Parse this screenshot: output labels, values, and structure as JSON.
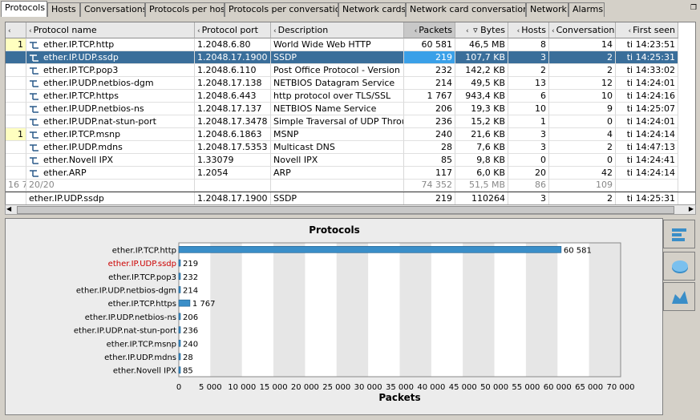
{
  "tabs": [
    "Protocols",
    "Hosts",
    "Conversations",
    "Protocols per host",
    "Protocols per conversation",
    "Network cards",
    "Network card conversations",
    "Network",
    "Alarms"
  ],
  "restore_icon": "restore-window-icon",
  "columns": [
    "",
    "Protocol name",
    "Protocol port",
    "Description",
    "Packets",
    "Bytes",
    "Hosts",
    "Conversations",
    "First seen"
  ],
  "rows": [
    [
      "1",
      "ether.IP.TCP.http",
      "1.2048.6.80",
      "World Wide Web HTTP",
      "60 581",
      "46,5 MB",
      "8",
      "14",
      "ti 14:23:51"
    ],
    [
      "",
      "ether.IP.UDP.ssdp",
      "1.2048.17.1900",
      "SSDP",
      "219",
      "107,7 KB",
      "3",
      "2",
      "ti 14:25:31"
    ],
    [
      "",
      "ether.IP.TCP.pop3",
      "1.2048.6.110",
      "Post Office Protocol - Version 3",
      "232",
      "142,2 KB",
      "2",
      "2",
      "ti 14:33:02"
    ],
    [
      "",
      "ether.IP.UDP.netbios-dgm",
      "1.2048.17.138",
      "NETBIOS Datagram Service",
      "214",
      "49,5 KB",
      "13",
      "12",
      "ti 14:24:01"
    ],
    [
      "",
      "ether.IP.TCP.https",
      "1.2048.6.443",
      "http protocol over TLS/SSL",
      "1 767",
      "943,4 KB",
      "6",
      "10",
      "ti 14:24:16"
    ],
    [
      "",
      "ether.IP.UDP.netbios-ns",
      "1.2048.17.137",
      "NETBIOS Name Service",
      "206",
      "19,3 KB",
      "10",
      "9",
      "ti 14:25:07"
    ],
    [
      "",
      "ether.IP.UDP.nat-stun-port",
      "1.2048.17.3478",
      "Simple Traversal of UDP Through",
      "236",
      "15,2 KB",
      "1",
      "0",
      "ti 14:24:01"
    ],
    [
      "1",
      "ether.IP.TCP.msnp",
      "1.2048.6.1863",
      "MSNP",
      "240",
      "21,6 KB",
      "3",
      "4",
      "ti 14:24:14"
    ],
    [
      "",
      "ether.IP.UDP.mdns",
      "1.2048.17.5353",
      "Multicast DNS",
      "28",
      "7,6 KB",
      "3",
      "2",
      "ti 14:47:13"
    ],
    [
      "",
      "ether.Novell IPX",
      "1.33079",
      "Novell IPX",
      "85",
      "9,8 KB",
      "0",
      "0",
      "ti 14:24:41"
    ],
    [
      "",
      "ether.ARP",
      "1.2054",
      "ARP",
      "117",
      "6,0 KB",
      "20",
      "42",
      "ti 14:24:14"
    ]
  ],
  "totals": [
    "16 7",
    "20/20",
    "",
    "",
    "74 352",
    "51,5 MB",
    "86",
    "109",
    ""
  ],
  "summary": [
    "",
    "ether.IP.UDP.ssdp",
    "1.2048.17.1900",
    "SSDP",
    "219",
    "110264",
    "3",
    "2",
    "ti 14:25:31"
  ],
  "chart_data": {
    "type": "bar",
    "orientation": "horizontal",
    "title": "Protocols",
    "xlabel": "Packets",
    "categories": [
      "ether.IP.TCP.http",
      "ether.IP.UDP.ssdp",
      "ether.IP.TCP.pop3",
      "ether.IP.UDP.netbios-dgm",
      "ether.IP.TCP.https",
      "ether.IP.UDP.netbios-ns",
      "ether.IP.UDP.nat-stun-port",
      "ether.IP.TCP.msnp",
      "ether.IP.UDP.mdns",
      "ether.Novell IPX"
    ],
    "values": [
      60581,
      219,
      232,
      214,
      1767,
      206,
      236,
      240,
      28,
      85
    ],
    "value_labels": [
      "60 581",
      "219",
      "232",
      "214",
      "1 767",
      "206",
      "236",
      "240",
      "28",
      "85"
    ],
    "highlighted": "ether.IP.UDP.ssdp",
    "xlim": [
      0,
      70000
    ],
    "ticks": [
      0,
      5000,
      10000,
      15000,
      20000,
      25000,
      30000,
      35000,
      40000,
      45000,
      50000,
      55000,
      60000,
      65000,
      70000
    ],
    "tick_labels": [
      "0",
      "5 000",
      "10 000",
      "15 000",
      "20 000",
      "25 000",
      "30 000",
      "35 000",
      "40 000",
      "45 000",
      "50 000",
      "55 000",
      "60 000",
      "65 000",
      "70 000"
    ],
    "bar_color": "#3a8ec8",
    "highlight_color": "#cc0000"
  },
  "sidebar": [
    "bar-chart-icon",
    "pie-chart-icon",
    "area-chart-icon"
  ]
}
